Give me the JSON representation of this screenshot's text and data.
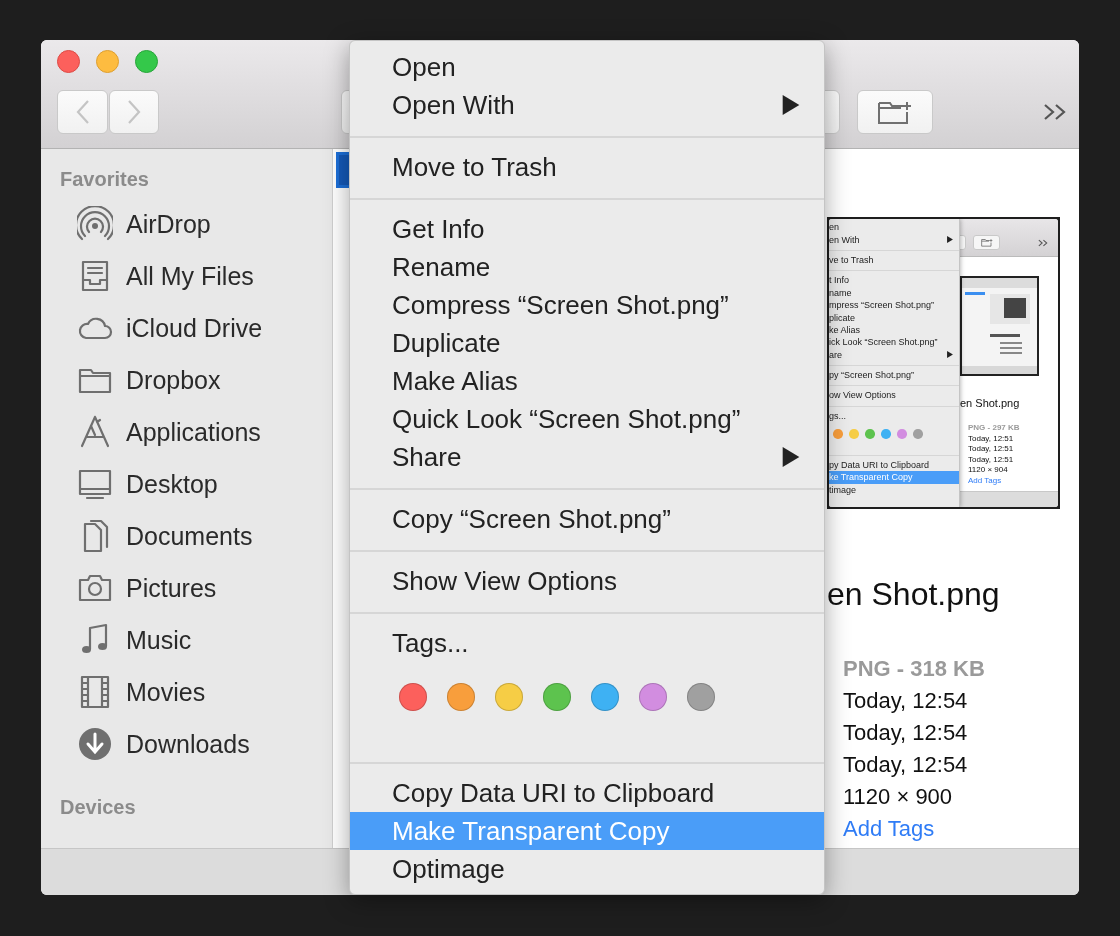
{
  "sidebar": {
    "sections": [
      {
        "heading": "Favorites",
        "items": [
          {
            "label": "AirDrop",
            "kind": "airdrop",
            "selected": false
          },
          {
            "label": "All My Files",
            "kind": "tray",
            "selected": false
          },
          {
            "label": "iCloud Drive",
            "kind": "cloud",
            "selected": false
          },
          {
            "label": "Dropbox",
            "kind": "folder",
            "selected": false
          },
          {
            "label": "Applications",
            "kind": "apps",
            "selected": false
          },
          {
            "label": "Desktop",
            "kind": "display",
            "selected": false
          },
          {
            "label": "Documents",
            "kind": "document",
            "selected": false
          },
          {
            "label": "Pictures",
            "kind": "camera",
            "selected": false
          },
          {
            "label": "Music",
            "kind": "note",
            "selected": false
          },
          {
            "label": "Movies",
            "kind": "film",
            "selected": false
          },
          {
            "label": "Downloads",
            "kind": "download",
            "selected": false
          }
        ]
      },
      {
        "heading": "Devices"
      }
    ]
  },
  "preview": {
    "thumbnail": {
      "menu": {
        "items": [
          {
            "kind": "item",
            "label": "en",
            "submenu": false,
            "selected": false
          },
          {
            "kind": "item",
            "label": "en With",
            "submenu": true,
            "selected": false
          },
          {
            "kind": "separator"
          },
          {
            "kind": "item",
            "label": "ve to Trash",
            "submenu": false,
            "selected": false
          },
          {
            "kind": "separator"
          },
          {
            "kind": "item",
            "label": "t Info",
            "submenu": false,
            "selected": false
          },
          {
            "kind": "item",
            "label": "name",
            "submenu": false,
            "selected": false
          },
          {
            "kind": "item",
            "label": "mpress “Screen Shot.png”",
            "submenu": false,
            "selected": false
          },
          {
            "kind": "item",
            "label": "plicate",
            "submenu": false,
            "selected": false
          },
          {
            "kind": "item",
            "label": "ke Alias",
            "submenu": false,
            "selected": false
          },
          {
            "kind": "item",
            "label": "ick Look “Screen Shot.png”",
            "submenu": false,
            "selected": false
          },
          {
            "kind": "item",
            "label": "are",
            "submenu": true,
            "selected": false
          },
          {
            "kind": "separator"
          },
          {
            "kind": "item",
            "label": "py “Screen Shot.png”",
            "submenu": false,
            "selected": false
          },
          {
            "kind": "separator"
          },
          {
            "kind": "item",
            "label": "ow View Options",
            "submenu": false,
            "selected": false
          },
          {
            "kind": "separator"
          },
          {
            "kind": "item",
            "label": "gs...",
            "submenu": false,
            "selected": false
          },
          {
            "kind": "tags",
            "colors": [
              {
                "color": "#f89e3c"
              },
              {
                "color": "#f6cd45"
              },
              {
                "color": "#5dc34e"
              },
              {
                "color": "#3eb1f3"
              },
              {
                "color": "#d28de0"
              },
              {
                "color": "#a0a0a0"
              }
            ]
          },
          {
            "kind": "separator"
          },
          {
            "kind": "item",
            "label": "py Data URI to Clipboard",
            "submenu": false,
            "selected": false
          },
          {
            "kind": "item",
            "label": "ke Transparent Copy",
            "submenu": false,
            "selected": true
          },
          {
            "kind": "item",
            "label": "timage",
            "submenu": false,
            "selected": false
          }
        ]
      },
      "title": "en Shot.png",
      "kind_size": "PNG - 297 KB",
      "dates": [
        "Today, 12:51",
        "Today, 12:51",
        "Today, 12:51"
      ],
      "dimensions": "1120 × 904",
      "add_tags": "Add Tags"
    },
    "title": "en Shot.png",
    "kind_size": "PNG - 318 KB",
    "dates": [
      "Today, 12:54",
      "Today, 12:54",
      "Today, 12:54"
    ],
    "dimensions": "1120 × 900",
    "add_tags": "Add Tags"
  },
  "context_menu": {
    "items": [
      {
        "kind": "item",
        "label": "Open",
        "submenu": false,
        "selected": false
      },
      {
        "kind": "item",
        "label": "Open With",
        "submenu": true,
        "selected": false
      },
      {
        "kind": "separator"
      },
      {
        "kind": "item",
        "label": "Move to Trash",
        "submenu": false,
        "selected": false
      },
      {
        "kind": "separator"
      },
      {
        "kind": "item",
        "label": "Get Info",
        "submenu": false,
        "selected": false
      },
      {
        "kind": "item",
        "label": "Rename",
        "submenu": false,
        "selected": false
      },
      {
        "kind": "item",
        "label": "Compress “Screen Shot.png”",
        "submenu": false,
        "selected": false
      },
      {
        "kind": "item",
        "label": "Duplicate",
        "submenu": false,
        "selected": false
      },
      {
        "kind": "item",
        "label": "Make Alias",
        "submenu": false,
        "selected": false
      },
      {
        "kind": "item",
        "label": "Quick Look “Screen Shot.png”",
        "submenu": false,
        "selected": false
      },
      {
        "kind": "item",
        "label": "Share",
        "submenu": true,
        "selected": false
      },
      {
        "kind": "separator"
      },
      {
        "kind": "item",
        "label": "Copy “Screen Shot.png”",
        "submenu": false,
        "selected": false
      },
      {
        "kind": "separator"
      },
      {
        "kind": "item",
        "label": "Show View Options",
        "submenu": false,
        "selected": false
      },
      {
        "kind": "separator"
      },
      {
        "kind": "item",
        "label": "Tags...",
        "submenu": false,
        "selected": false
      },
      {
        "kind": "tags",
        "colors": [
          {
            "color": "#fc605c"
          },
          {
            "color": "#f89e3c"
          },
          {
            "color": "#f6cd45"
          },
          {
            "color": "#5dc34e"
          },
          {
            "color": "#3eb1f3"
          },
          {
            "color": "#d28de0"
          },
          {
            "color": "#a0a0a0"
          }
        ]
      },
      {
        "kind": "separator"
      },
      {
        "kind": "item",
        "label": "Copy Data URI to Clipboard",
        "submenu": false,
        "selected": false
      },
      {
        "kind": "item",
        "label": "Make Transparent Copy",
        "submenu": false,
        "selected": true
      },
      {
        "kind": "item",
        "label": "Optimage",
        "submenu": false,
        "selected": false
      }
    ]
  }
}
